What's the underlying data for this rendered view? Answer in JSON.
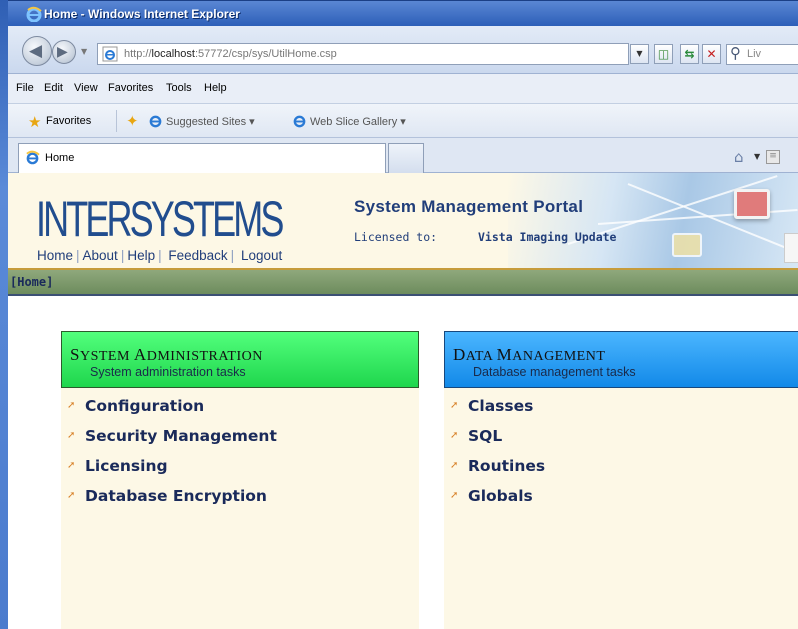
{
  "window": {
    "title": "Home - Windows Internet Explorer"
  },
  "address_bar": {
    "url_prefix": "http://",
    "url_host": "localhost",
    "url_rest": ":57772/csp/sys/UtilHome.csp",
    "search_placeholder": "Liv"
  },
  "menu": {
    "items": [
      "File",
      "Edit",
      "View",
      "Favorites",
      "Tools",
      "Help"
    ]
  },
  "favorites_bar": {
    "favorites_label": "Favorites",
    "links": [
      "Suggested Sites ▾",
      "Web Slice Gallery ▾"
    ]
  },
  "tabs": [
    {
      "label": "Home"
    }
  ],
  "portal": {
    "logo": "INTERSYSTEMS",
    "nav": [
      "Home",
      "About",
      "Help",
      "Feedback",
      "Logout"
    ],
    "title": "System Management Portal",
    "license_label": "Licensed to:",
    "license_value": "Vista Imaging Update",
    "breadcrumb": "[Home]"
  },
  "panels": [
    {
      "title_cap1": "S",
      "title_rest1": "YSTEM ",
      "title_cap2": "A",
      "title_rest2": "DMINISTRATION",
      "subtitle": "System administration tasks",
      "items": [
        "Configuration",
        "Security Management",
        "Licensing",
        "Database Encryption"
      ]
    },
    {
      "title_cap1": "D",
      "title_rest1": "ATA ",
      "title_cap2": "M",
      "title_rest2": "ANAGEMENT",
      "subtitle": "Database management tasks",
      "items": [
        "Classes",
        "SQL",
        "Routines",
        "Globals"
      ]
    }
  ],
  "colors": {
    "title_bar": "#2d5fb8",
    "portal_text": "#213e7a",
    "admin_header": "#1fd64d",
    "data_header": "#1289e8",
    "panel_bg": "#fdf8e6",
    "bullet": "#d8822a"
  }
}
